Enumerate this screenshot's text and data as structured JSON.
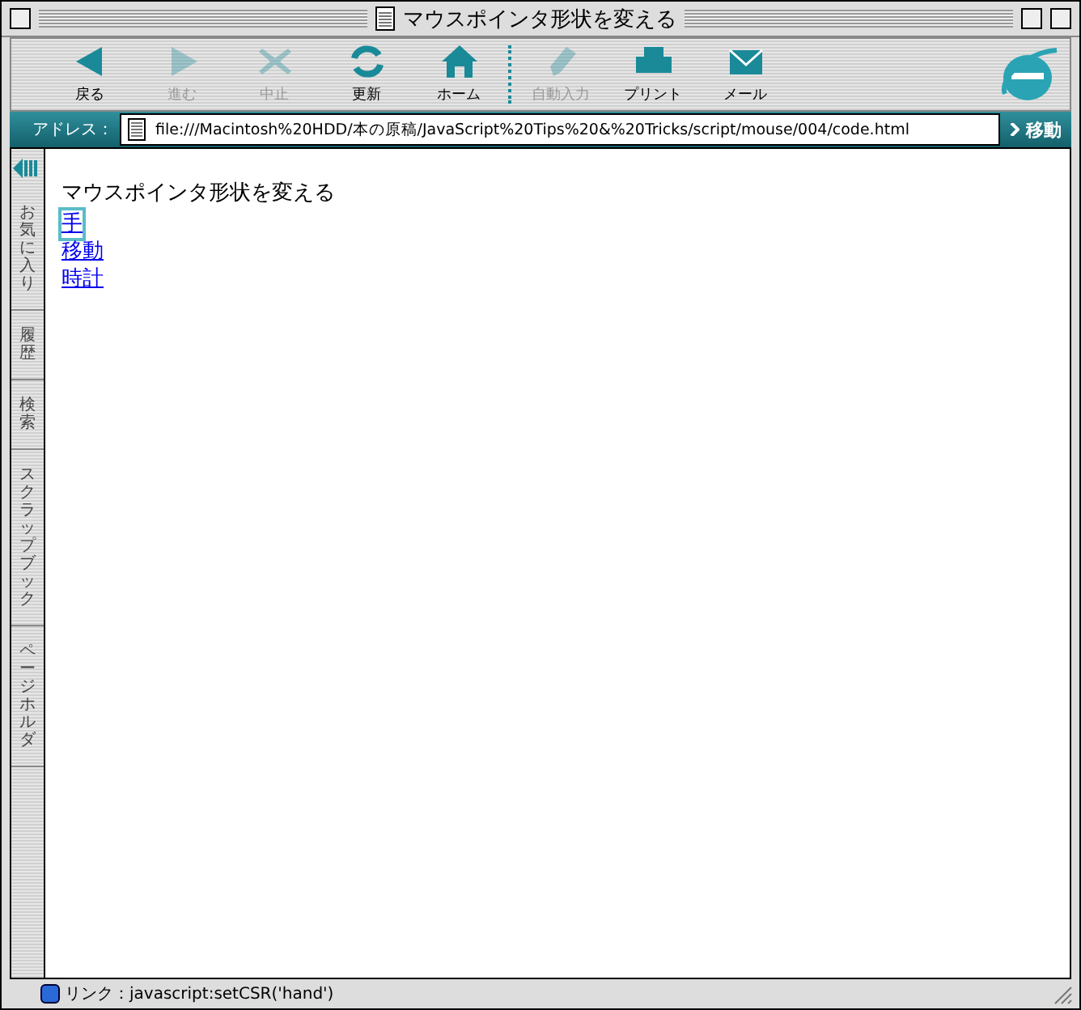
{
  "window": {
    "title": "マウスポインタ形状を変える"
  },
  "toolbar": [
    {
      "kind": "back",
      "label": "戻る",
      "disabled": false
    },
    {
      "kind": "forward",
      "label": "進む",
      "disabled": true
    },
    {
      "kind": "stop",
      "label": "中止",
      "disabled": true
    },
    {
      "kind": "refresh",
      "label": "更新",
      "disabled": false
    },
    {
      "kind": "home",
      "label": "ホーム",
      "disabled": false
    },
    {
      "kind": "autofill",
      "label": "自動入力",
      "disabled": true
    },
    {
      "kind": "print",
      "label": "プリント",
      "disabled": false
    },
    {
      "kind": "mail",
      "label": "メール",
      "disabled": false
    }
  ],
  "address_bar": {
    "label": "アドレス：",
    "value": "file:///Macintosh%20HDD/本の原稿/JavaScript%20Tips%20&%20Tricks/script/mouse/004/code.html",
    "go_button": "移動"
  },
  "sidebar_tabs": [
    "お気に入り",
    "履歴",
    "検索",
    "スクラップブック",
    "ページホルダ"
  ],
  "page": {
    "heading": "マウスポインタ形状を変える",
    "links": [
      {
        "label": "手",
        "focused": true
      },
      {
        "label": "移動",
        "focused": false
      },
      {
        "label": "時計",
        "focused": false
      }
    ]
  },
  "status_bar": {
    "text": "リンク：javascript:setCSR('hand')"
  }
}
